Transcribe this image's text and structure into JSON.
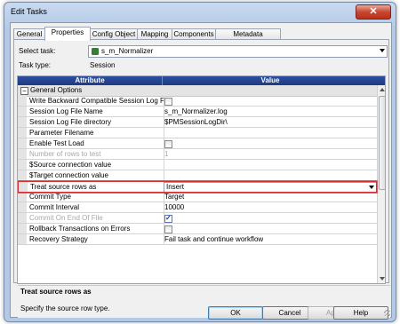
{
  "window": {
    "title": "Edit Tasks",
    "close_glyph": "✕"
  },
  "tabs": [
    {
      "label": "General",
      "active": false
    },
    {
      "label": "Properties",
      "active": true
    },
    {
      "label": "Config Object",
      "active": false
    },
    {
      "label": "Mapping",
      "active": false
    },
    {
      "label": "Components",
      "active": false
    },
    {
      "label": "Metadata Extensions",
      "active": false
    }
  ],
  "task": {
    "label": "Select task:",
    "value": "s_m_Normalizer",
    "icon": "session-icon"
  },
  "task_type": {
    "label": "Task type:",
    "value": "Session"
  },
  "grid": {
    "columns": {
      "attribute": "Attribute",
      "value": "Value"
    },
    "group": {
      "toggle": "−",
      "label": "General Options"
    },
    "rows": [
      {
        "attr": "Write Backward Compatible Session Log File",
        "kind": "checkbox",
        "checked": false,
        "disabled": false
      },
      {
        "attr": "Session Log File Name",
        "kind": "text",
        "value": "s_m_Normalizer.log",
        "disabled": false
      },
      {
        "attr": "Session Log File directory",
        "kind": "text",
        "value": "$PMSessionLogDir\\",
        "disabled": false
      },
      {
        "attr": "Parameter Filename",
        "kind": "text",
        "value": "",
        "disabled": false
      },
      {
        "attr": "Enable Test Load",
        "kind": "checkbox",
        "checked": false,
        "disabled": false
      },
      {
        "attr": "Number of rows to test",
        "kind": "text",
        "value": "1",
        "disabled": true
      },
      {
        "attr": "$Source connection value",
        "kind": "text",
        "value": "",
        "disabled": false
      },
      {
        "attr": "$Target connection value",
        "kind": "text",
        "value": "",
        "disabled": false
      },
      {
        "attr": "Treat source rows as",
        "kind": "select",
        "value": "Insert",
        "disabled": false,
        "selected": true
      },
      {
        "attr": "Commit Type",
        "kind": "text",
        "value": "Target",
        "disabled": false
      },
      {
        "attr": "Commit Interval",
        "kind": "text",
        "value": "10000",
        "disabled": false
      },
      {
        "attr": "Commit On End Of File",
        "kind": "checkbox",
        "checked": true,
        "disabled": true
      },
      {
        "attr": "Rollback Transactions on Errors",
        "kind": "checkbox",
        "checked": false,
        "disabled": false
      },
      {
        "attr": "Recovery Strategy",
        "kind": "text",
        "value": "Fail task and continue workflow",
        "disabled": false
      }
    ]
  },
  "description": {
    "title": "Treat source rows as",
    "text": "Specify the source row type."
  },
  "buttons": {
    "ok": "OK",
    "cancel": "Cancel",
    "apply": "Apply",
    "help": "Help"
  }
}
